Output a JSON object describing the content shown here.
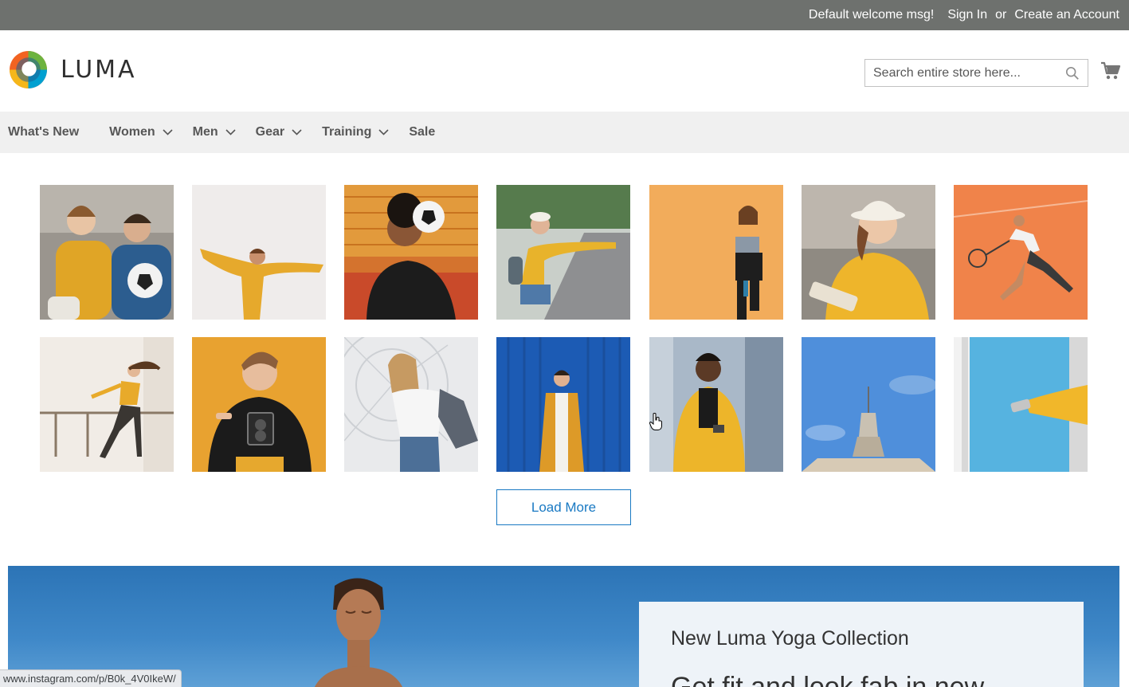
{
  "top_panel": {
    "welcome": "Default welcome msg!",
    "sign_in": "Sign In",
    "or": "or",
    "create_account": "Create an Account"
  },
  "header": {
    "logo_text": "LUMA",
    "search_placeholder": "Search entire store here..."
  },
  "nav": {
    "items": [
      {
        "label": "What's New",
        "has_dropdown": false
      },
      {
        "label": "Women",
        "has_dropdown": true
      },
      {
        "label": "Men",
        "has_dropdown": true
      },
      {
        "label": "Gear",
        "has_dropdown": true
      },
      {
        "label": "Training",
        "has_dropdown": true
      },
      {
        "label": "Sale",
        "has_dropdown": false
      }
    ]
  },
  "gallery": {
    "load_more": "Load More"
  },
  "banner": {
    "promo_title": "New Luma Yoga Collection",
    "promo_sub": "Get fit and look fab in new"
  },
  "status_bar": {
    "url": "www.instagram.com/p/B0k_4V0IkeW/"
  },
  "colors": {
    "top_panel_bg": "#6e716e",
    "nav_bg": "#f0f0f0",
    "accent_blue": "#1979c3"
  }
}
